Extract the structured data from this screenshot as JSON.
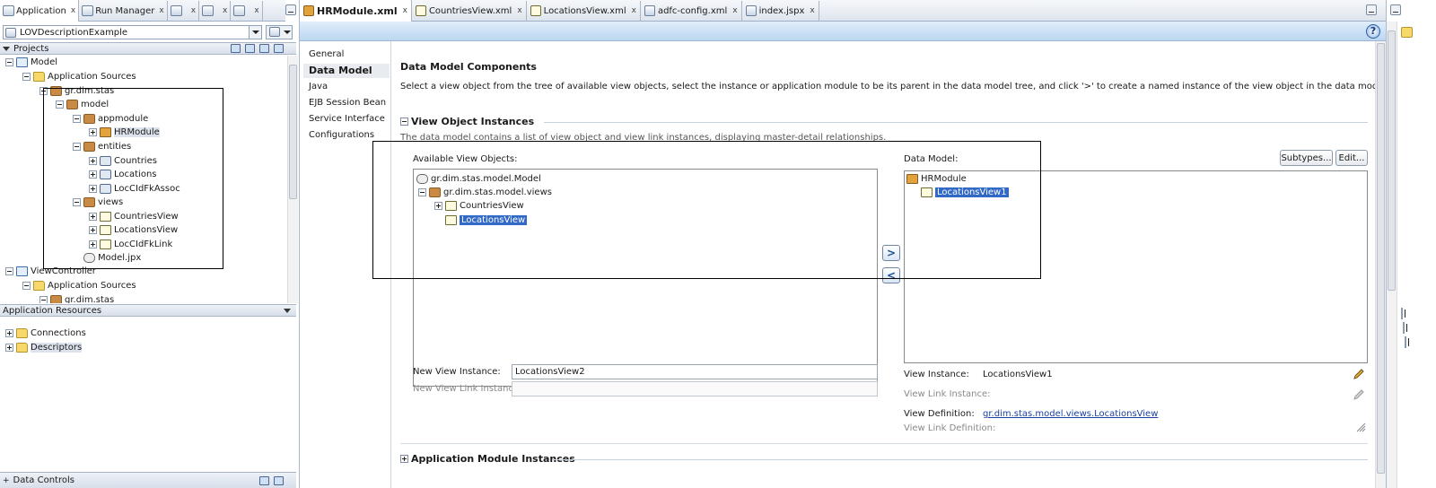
{
  "left_tabs": [
    {
      "label": "Application",
      "close": "x"
    },
    {
      "label": "Run Manager",
      "close": "x"
    },
    {
      "label": "",
      "close": "x"
    },
    {
      "label": "",
      "close": "x"
    },
    {
      "label": "",
      "close": "x"
    }
  ],
  "application_selector": {
    "value": "LOVDescriptionExample"
  },
  "projects_panel": {
    "title": "Projects"
  },
  "project_tree": [
    {
      "label": "Model",
      "icon": "project-icon",
      "expander": "minus"
    },
    {
      "label": "Application Sources",
      "icon": "folder-icon",
      "expander": "minus"
    },
    {
      "label": "gr.dim.stas",
      "icon": "package-icon",
      "expander": "minus"
    },
    {
      "label": "model",
      "icon": "package-icon",
      "expander": "minus"
    },
    {
      "label": "appmodule",
      "icon": "package-icon",
      "expander": "minus"
    },
    {
      "label": "HRModule",
      "icon": "app-module-icon",
      "expander": "plus",
      "selected": true
    },
    {
      "label": "entities",
      "icon": "package-icon",
      "expander": "minus"
    },
    {
      "label": "Countries",
      "icon": "entity-object-icon",
      "expander": "plus"
    },
    {
      "label": "Locations",
      "icon": "entity-object-icon",
      "expander": "plus"
    },
    {
      "label": "LocCIdFkAssoc",
      "icon": "association-icon",
      "expander": "plus"
    },
    {
      "label": "views",
      "icon": "package-icon",
      "expander": "minus"
    },
    {
      "label": "CountriesView",
      "icon": "view-object-icon",
      "expander": "plus"
    },
    {
      "label": "LocationsView",
      "icon": "view-object-icon",
      "expander": "plus"
    },
    {
      "label": "LocCIdFkLink",
      "icon": "view-link-icon",
      "expander": "plus"
    },
    {
      "label": "Model.jpx",
      "icon": "jpx-file-icon",
      "expander": "none"
    },
    {
      "label": "ViewController",
      "icon": "project-icon",
      "expander": "minus"
    },
    {
      "label": "Application Sources",
      "icon": "folder-icon",
      "expander": "minus"
    },
    {
      "label": "gr.dim.stas",
      "icon": "package-icon",
      "expander": "minus"
    }
  ],
  "app_resources": {
    "title": "Application Resources",
    "items": [
      {
        "label": "Connections",
        "icon": "folder-icon"
      },
      {
        "label": "Descriptors",
        "icon": "folder-icon"
      }
    ]
  },
  "data_controls": {
    "title": "Data Controls"
  },
  "editor_tabs": [
    {
      "label": "HRModule.xml",
      "close": "x",
      "active": true
    },
    {
      "label": "CountriesView.xml",
      "close": "x"
    },
    {
      "label": "LocationsView.xml",
      "close": "x"
    },
    {
      "label": "adfc-config.xml",
      "close": "x"
    },
    {
      "label": "index.jspx",
      "close": "x"
    }
  ],
  "help_label": "?",
  "nav_items": [
    {
      "label": "General"
    },
    {
      "label": "Data Model",
      "active": true
    },
    {
      "label": "Java"
    },
    {
      "label": "EJB Session Bean"
    },
    {
      "label": "Service Interface"
    },
    {
      "label": "Configurations"
    }
  ],
  "content": {
    "title": "Data Model Components",
    "description": "Select a view object from the tree of available view objects, select the instance or application module to be its parent in the data model tree, and click '>' to create a named instance of the view object in the data model.",
    "voi_section_title": "View Object Instances",
    "voi_description": "The data model contains a list of view object and view link instances, displaying master-detail relationships.",
    "available_label": "Available View Objects:",
    "available_tree": [
      {
        "label": "gr.dim.stas.model.Model"
      },
      {
        "label": "gr.dim.stas.model.views"
      },
      {
        "label": "CountriesView"
      },
      {
        "label": "LocationsView",
        "selected": true
      }
    ],
    "data_model_label": "Data Model:",
    "data_model_tree": [
      {
        "label": "HRModule"
      },
      {
        "label": "LocationsView1",
        "selected": true
      }
    ],
    "subtypes_button": "Subtypes...",
    "edit_button": "Edit...",
    "add_button": ">",
    "remove_button": "<",
    "new_view_instance_label": "New View Instance:",
    "new_view_instance_value": "LocationsView2",
    "new_view_link_label": "New View Link Instance:",
    "new_view_link_value": "",
    "view_instance_label": "View Instance:",
    "view_instance_value": "LocationsView1",
    "view_link_instance_label": "View Link Instance:",
    "view_definition_label": "View Definition:",
    "view_definition_value": "gr.dim.stas.model.views.LocationsView",
    "view_link_definition_label": "View Link Definition:",
    "ami_section_title": "Application Module Instances"
  },
  "colors": {
    "selection": "#3169c6",
    "header_bar": "#bcd6f1",
    "link": "#1a3fa0"
  }
}
